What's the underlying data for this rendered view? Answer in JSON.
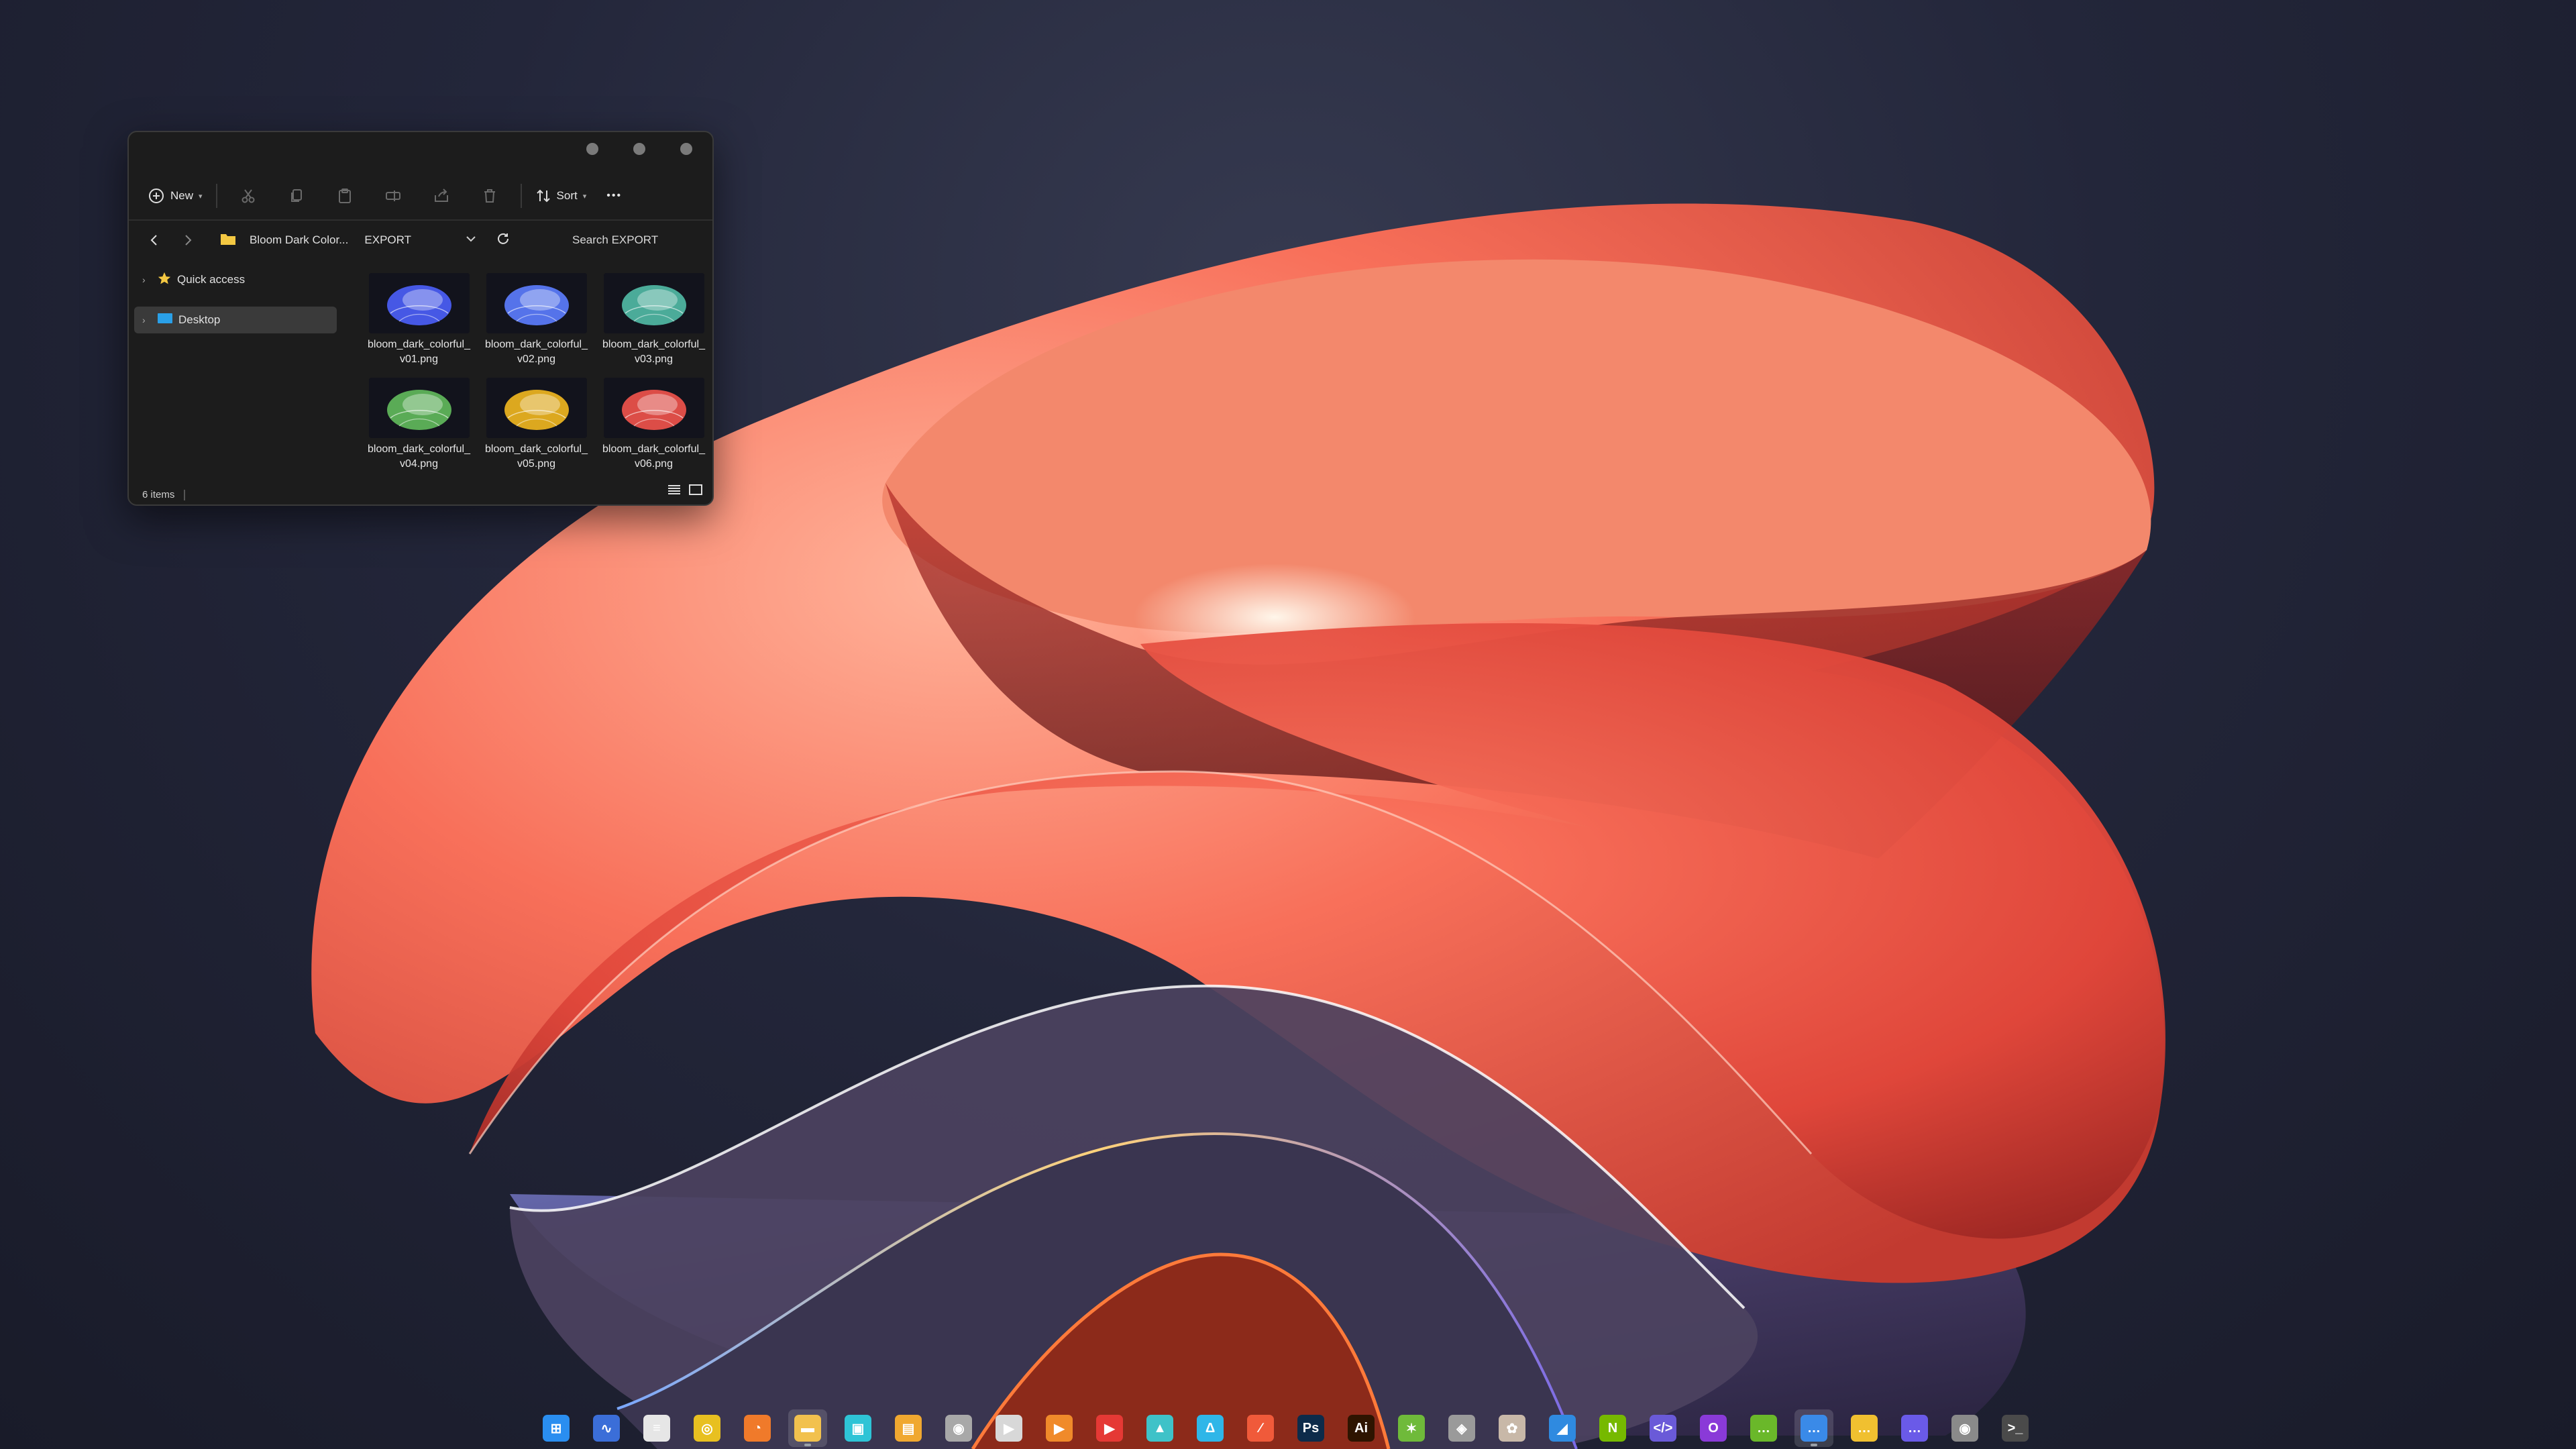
{
  "toolbar": {
    "new_label": "New",
    "sort_label": "Sort",
    "icons": [
      "cut-icon",
      "copy-icon",
      "paste-icon",
      "rename-icon",
      "share-icon",
      "delete-icon"
    ],
    "more_label": "•••"
  },
  "address": {
    "breadcrumb_parent": "Bloom Dark Color...",
    "breadcrumb_current": "EXPORT",
    "search_placeholder": "Search EXPORT"
  },
  "sidebar": {
    "items": [
      {
        "label": "Quick access",
        "icon": "star-icon"
      },
      {
        "label": "Desktop",
        "icon": "desktop-icon"
      }
    ]
  },
  "files": [
    {
      "name": "bloom_dark_colorful_v01.png",
      "tint": "#4a5cf0"
    },
    {
      "name": "bloom_dark_colorful_v02.png",
      "tint": "#5a78f5"
    },
    {
      "name": "bloom_dark_colorful_v03.png",
      "tint": "#4fb3a0"
    },
    {
      "name": "bloom_dark_colorful_v04.png",
      "tint": "#5fb35a"
    },
    {
      "name": "bloom_dark_colorful_v05.png",
      "tint": "#e8b020"
    },
    {
      "name": "bloom_dark_colorful_v06.png",
      "tint": "#e8504a"
    }
  ],
  "status": {
    "items_count": "6 items"
  },
  "taskbar": {
    "apps": [
      {
        "name": "windows-start-icon",
        "color": "#2a8ef0",
        "glyph": "⊞"
      },
      {
        "name": "audio-waveform-app-icon",
        "color": "#3b6ed8",
        "glyph": "∿"
      },
      {
        "name": "notes-app-icon",
        "color": "#e6e6e6",
        "glyph": "≡"
      },
      {
        "name": "chrome-icon",
        "color": "#e8c020",
        "glyph": "◎"
      },
      {
        "name": "firefox-icon",
        "color": "#f07a2a",
        "glyph": "◔"
      },
      {
        "name": "file-explorer-icon",
        "color": "#f2c14e",
        "glyph": "▬"
      },
      {
        "name": "tablet-app-icon",
        "color": "#2ec4d6",
        "glyph": "▣"
      },
      {
        "name": "save-disk-icon",
        "color": "#f0a830",
        "glyph": "▤"
      },
      {
        "name": "speaker-app-icon",
        "color": "#a8a8a8",
        "glyph": "◉"
      },
      {
        "name": "media-player-icon",
        "color": "#d8d8d8",
        "glyph": "▶"
      },
      {
        "name": "video-player-orange-icon",
        "color": "#f08a2a",
        "glyph": "▶"
      },
      {
        "name": "youtube-icon",
        "color": "#e53935",
        "glyph": "▶"
      },
      {
        "name": "image-viewer-icon",
        "color": "#3fc2c8",
        "glyph": "▲"
      },
      {
        "name": "affinity-designer-icon",
        "color": "#2fb6e8",
        "glyph": "Δ"
      },
      {
        "name": "paint-app-icon",
        "color": "#f05a3a",
        "glyph": "∕"
      },
      {
        "name": "photoshop-icon",
        "color": "#0d2b4a",
        "glyph": "Ps"
      },
      {
        "name": "illustrator-icon",
        "color": "#2e1400",
        "glyph": "Ai"
      },
      {
        "name": "recycle-app-icon",
        "color": "#6fba3a",
        "glyph": "✶"
      },
      {
        "name": "3d-box-icon",
        "color": "#9a9a9a",
        "glyph": "◈"
      },
      {
        "name": "color-palette-icon",
        "color": "#c8b8a8",
        "glyph": "✿"
      },
      {
        "name": "maps-app-icon",
        "color": "#2f8ae0",
        "glyph": "◢"
      },
      {
        "name": "nvidia-icon",
        "color": "#76b900",
        "glyph": "N"
      },
      {
        "name": "code-editor-icon",
        "color": "#6a5ad8",
        "glyph": "</>"
      },
      {
        "name": "outlook-icon",
        "color": "#8a3ad8",
        "glyph": "O"
      },
      {
        "name": "chat-green-icon",
        "color": "#6ab82a",
        "glyph": "…"
      },
      {
        "name": "chat-blue-icon",
        "color": "#3a8ae8",
        "glyph": "…"
      },
      {
        "name": "chat-yellow-icon",
        "color": "#f0c030",
        "glyph": "…"
      },
      {
        "name": "chat-purple-icon",
        "color": "#6a5ae8",
        "glyph": "…"
      },
      {
        "name": "camera-app-icon",
        "color": "#8a8a8a",
        "glyph": "◉"
      },
      {
        "name": "terminal-icon",
        "color": "#4a4a4a",
        "glyph": ">_"
      }
    ]
  }
}
